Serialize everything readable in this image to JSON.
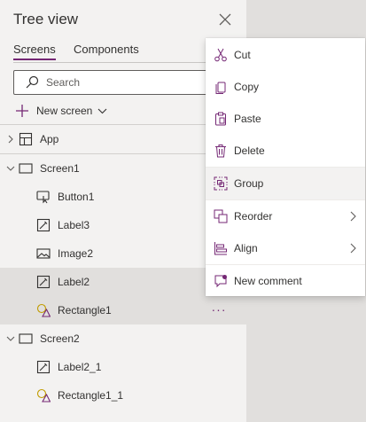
{
  "panel": {
    "title": "Tree view",
    "tabs": [
      {
        "label": "Screens",
        "active": true
      },
      {
        "label": "Components",
        "active": false
      }
    ],
    "search": {
      "placeholder": "Search",
      "value": ""
    },
    "new_screen_label": "New screen",
    "tree": [
      {
        "label": "App",
        "type": "app",
        "level": 0,
        "expandable": true,
        "expanded": false
      },
      {
        "label": "Screen1",
        "type": "screen",
        "level": 0,
        "expandable": true,
        "expanded": true
      },
      {
        "label": "Button1",
        "type": "button",
        "level": 1
      },
      {
        "label": "Label3",
        "type": "label",
        "level": 1
      },
      {
        "label": "Image2",
        "type": "image",
        "level": 1
      },
      {
        "label": "Label2",
        "type": "label",
        "level": 1,
        "selected": true
      },
      {
        "label": "Rectangle1",
        "type": "rectangle",
        "level": 1,
        "selected": true
      },
      {
        "label": "Screen2",
        "type": "screen",
        "level": 0,
        "expandable": true,
        "expanded": true
      },
      {
        "label": "Label2_1",
        "type": "label",
        "level": 1
      },
      {
        "label": "Rectangle1_1",
        "type": "rectangle",
        "level": 1
      }
    ],
    "more_glyph": "···"
  },
  "context_menu": {
    "items": [
      {
        "label": "Cut",
        "icon": "scissors-icon"
      },
      {
        "label": "Copy",
        "icon": "copy-icon"
      },
      {
        "label": "Paste",
        "icon": "paste-icon"
      },
      {
        "label": "Delete",
        "icon": "trash-icon"
      },
      {
        "label": "Group",
        "icon": "group-icon",
        "hover": true
      },
      {
        "label": "Reorder",
        "icon": "reorder-icon",
        "submenu": true
      },
      {
        "label": "Align",
        "icon": "align-icon",
        "submenu": true
      },
      {
        "label": "New comment",
        "icon": "comment-icon"
      }
    ]
  },
  "colors": {
    "accent": "#742774",
    "panel_bg": "#f3f2f1",
    "canvas_bg": "#e1dfdd",
    "selected_row": "#e1dfdd"
  }
}
